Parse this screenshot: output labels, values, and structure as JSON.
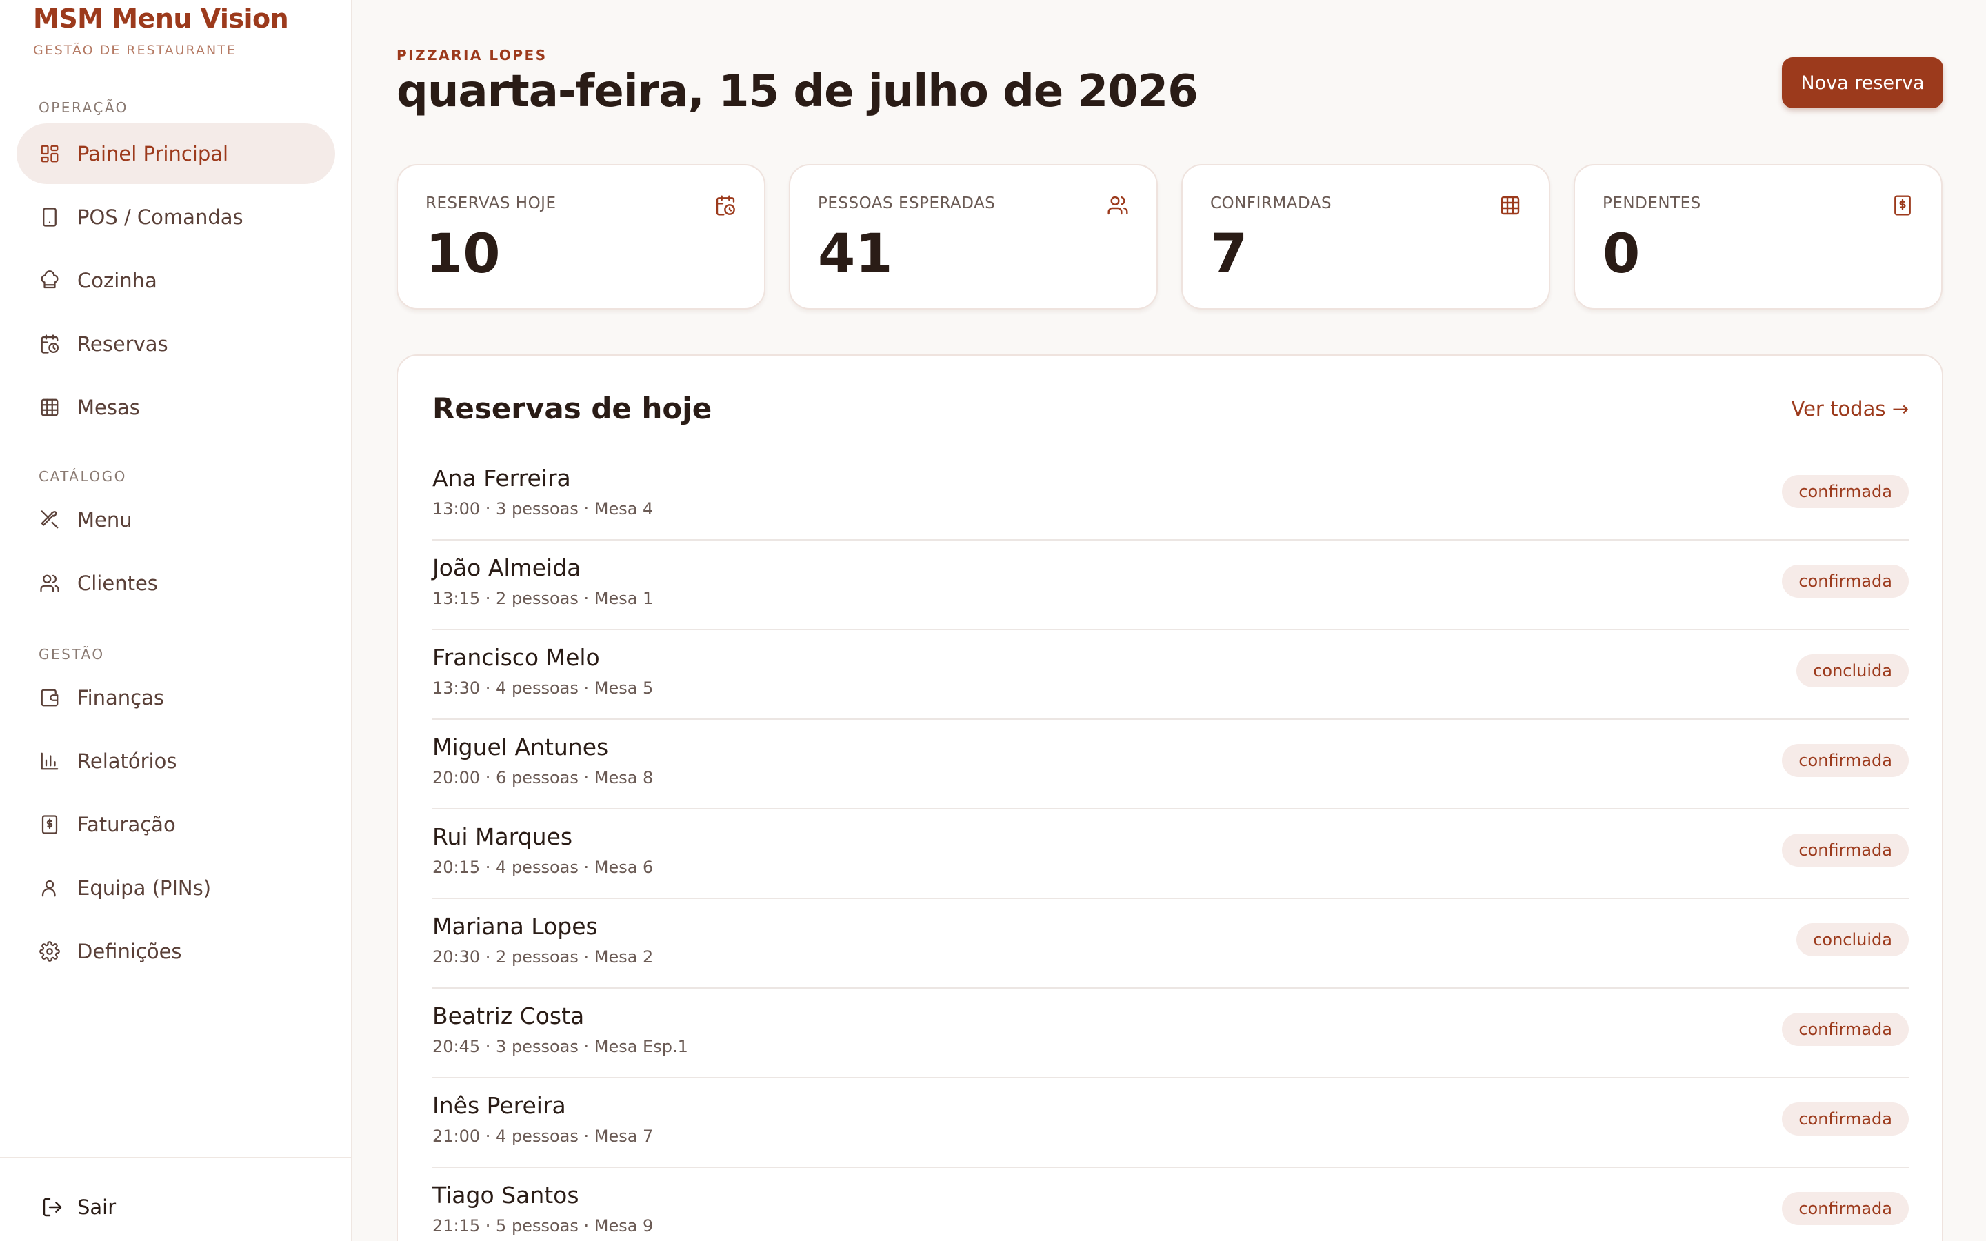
{
  "brand": {
    "title": "MSM Menu Vision",
    "subtitle": "GESTÃO DE RESTAURANTE"
  },
  "sidebar": {
    "sections": [
      {
        "heading": "OPERAÇÃO",
        "items": [
          {
            "label": "Painel Principal",
            "icon": "dashboard-icon",
            "active": true
          },
          {
            "label": "POS / Comandas",
            "icon": "tablet-icon"
          },
          {
            "label": "Cozinha",
            "icon": "chef-hat-icon"
          },
          {
            "label": "Reservas",
            "icon": "calendar-clock-icon"
          },
          {
            "label": "Mesas",
            "icon": "grid-icon"
          }
        ]
      },
      {
        "heading": "CATÁLOGO",
        "items": [
          {
            "label": "Menu",
            "icon": "utensils-icon"
          },
          {
            "label": "Clientes",
            "icon": "users-icon"
          }
        ]
      },
      {
        "heading": "GESTÃO",
        "items": [
          {
            "label": "Finanças",
            "icon": "wallet-icon"
          },
          {
            "label": "Relatórios",
            "icon": "bar-chart-icon"
          },
          {
            "label": "Faturação",
            "icon": "invoice-icon"
          },
          {
            "label": "Equipa (PINs)",
            "icon": "user-icon"
          },
          {
            "label": "Definições",
            "icon": "gear-icon"
          }
        ]
      }
    ],
    "logout": "Sair"
  },
  "header": {
    "restaurant": "PIZZARIA LOPES",
    "date": "quarta-feira, 15 de julho de 2026",
    "new_button": "Nova reserva"
  },
  "stats": [
    {
      "label": "RESERVAS HOJE",
      "value": "10",
      "icon": "calendar-clock-icon"
    },
    {
      "label": "PESSOAS ESPERADAS",
      "value": "41",
      "icon": "users-icon"
    },
    {
      "label": "CONFIRMADAS",
      "value": "7",
      "icon": "grid-icon"
    },
    {
      "label": "PENDENTES",
      "value": "0",
      "icon": "invoice-icon"
    }
  ],
  "reservations": {
    "title": "Reservas de hoje",
    "view_all": "Ver todas →",
    "rows": [
      {
        "name": "Ana Ferreira",
        "meta": "13:00 · 3 pessoas · Mesa 4",
        "status": "confirmada"
      },
      {
        "name": "João Almeida",
        "meta": "13:15 · 2 pessoas · Mesa 1",
        "status": "confirmada"
      },
      {
        "name": "Francisco Melo",
        "meta": "13:30 · 4 pessoas · Mesa 5",
        "status": "concluida"
      },
      {
        "name": "Miguel Antunes",
        "meta": "20:00 · 6 pessoas · Mesa 8",
        "status": "confirmada"
      },
      {
        "name": "Rui Marques",
        "meta": "20:15 · 4 pessoas · Mesa 6",
        "status": "confirmada"
      },
      {
        "name": "Mariana Lopes",
        "meta": "20:30 · 2 pessoas · Mesa 2",
        "status": "concluida"
      },
      {
        "name": "Beatriz Costa",
        "meta": "20:45 · 3 pessoas · Mesa Esp.1",
        "status": "confirmada"
      },
      {
        "name": "Inês Pereira",
        "meta": "21:00 · 4 pessoas · Mesa 7",
        "status": "confirmada"
      },
      {
        "name": "Tiago Santos",
        "meta": "21:15 · 5 pessoas · Mesa 9",
        "status": "confirmada"
      }
    ]
  },
  "colors": {
    "accent": "#9c3a1c",
    "background": "#faf8f6",
    "badge_bg": "#f6ebe8"
  }
}
